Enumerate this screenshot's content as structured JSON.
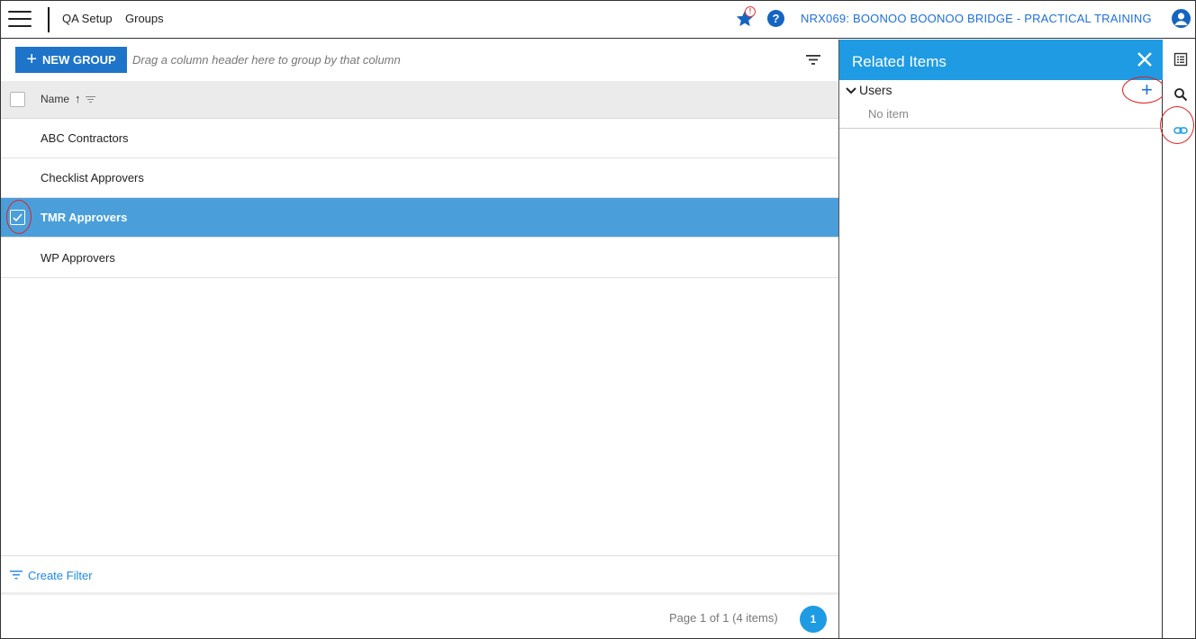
{
  "topbar": {
    "breadcrumb": [
      "QA Setup",
      "Groups"
    ],
    "notification_badge": "!",
    "help_glyph": "?",
    "project": "NRX069: BOONOO BOONOO BRIDGE - PRACTICAL TRAINING",
    "icons": [
      "menu-icon",
      "star-icon",
      "help-icon",
      "user-icon"
    ]
  },
  "toolbar": {
    "new_group_label": "NEW GROUP",
    "group_hint": "Drag a column header here to group by that column"
  },
  "grid": {
    "columns": [
      {
        "label": "Name",
        "sort": "ascending",
        "sort_glyph": "↑"
      }
    ],
    "rows": [
      {
        "name": "ABC Contractors",
        "selected": false
      },
      {
        "name": "Checklist Approvers",
        "selected": false
      },
      {
        "name": "TMR Approvers",
        "selected": true
      },
      {
        "name": "WP Approvers",
        "selected": false
      }
    ]
  },
  "footer": {
    "create_filter_label": "Create Filter",
    "page_info": "Page 1 of 1 (4 items)",
    "current_page": "1"
  },
  "related_panel": {
    "title": "Related Items",
    "sections": [
      {
        "label": "Users",
        "empty_text": "No item",
        "add_glyph": "+"
      }
    ]
  },
  "rail": {
    "icons": [
      "list-icon",
      "search-icon",
      "link-icon"
    ]
  },
  "colors": {
    "accent": "#1e9be3",
    "button": "#1e74c9",
    "selected_row": "#4a9fdb",
    "link": "#1e6fd9",
    "annotation": "#e02020"
  }
}
